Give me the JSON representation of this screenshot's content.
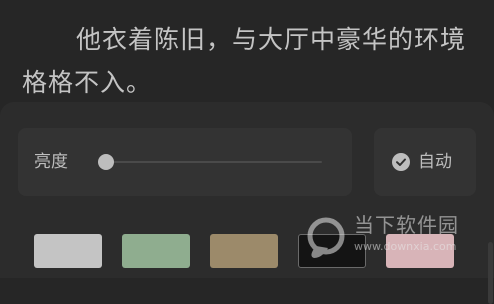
{
  "reader": {
    "text": "他衣着陈旧，与大厅中豪华的环境格格不入。"
  },
  "settings": {
    "brightness_label": "亮度",
    "brightness_level": 0.0,
    "auto_label": "自动",
    "auto_checked": true,
    "auto_icon": "check-circle-icon",
    "themes": [
      {
        "name": "gray",
        "color": "#c4c4c4"
      },
      {
        "name": "green",
        "color": "#8fad8f"
      },
      {
        "name": "tan",
        "color": "#9c8a6a"
      },
      {
        "name": "black",
        "color": "#141414"
      },
      {
        "name": "pink",
        "color": "#d8b4b8"
      }
    ]
  },
  "watermark": {
    "name": "当下软件园",
    "url": "www.downxia.com"
  }
}
